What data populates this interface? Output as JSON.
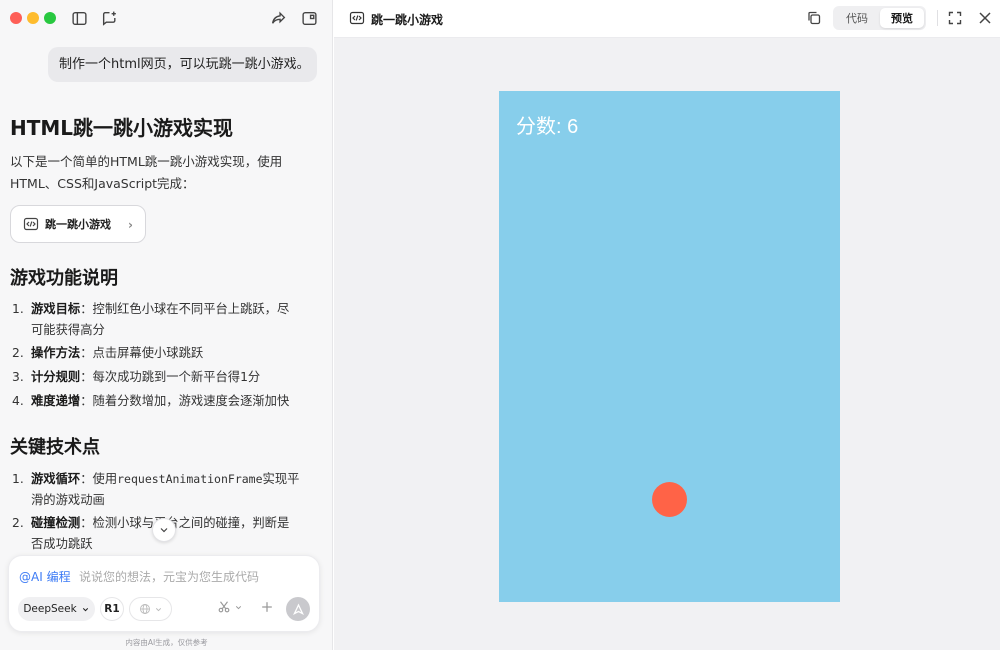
{
  "left": {
    "user_message": "制作一个html网页，可以玩跳一跳小游戏。",
    "heading": "HTML跳一跳小游戏实现",
    "intro_line1": "以下是一个简单的HTML跳一跳小游戏实现，使用",
    "intro_line2": "HTML、CSS和JavaScript完成：",
    "artifact_card": {
      "label": "跳一跳小游戏",
      "chevron": "›"
    },
    "section1_title": "游戏功能说明",
    "features": [
      {
        "num": "1.",
        "term": "游戏目标",
        "sep": "：",
        "text": "控制红色小球在不同平台上跳跃，尽",
        "text2": "可能获得高分"
      },
      {
        "num": "2.",
        "term": "操作方法",
        "sep": "：",
        "text": "点击屏幕使小球跳跃"
      },
      {
        "num": "3.",
        "term": "计分规则",
        "sep": "：",
        "text": "每次成功跳到一个新平台得1分"
      },
      {
        "num": "4.",
        "term": "难度递增",
        "sep": "：",
        "text": "随着分数增加，游戏速度会逐渐加快"
      }
    ],
    "section2_title": "关键技术点",
    "tech": [
      {
        "num": "1.",
        "term": "游戏循环",
        "sep": "：",
        "pre": "使用",
        "code": "requestAnimationFrame",
        "post": "实现平",
        "text2": "滑的游戏动画"
      },
      {
        "num": "2.",
        "term": "碰撞检测",
        "sep": "：",
        "text": "检测小球与平台之间的碰撞，判断是",
        "text2": "否成功跳跃"
      }
    ]
  },
  "input": {
    "ai_tag": "@AI 编程",
    "placeholder": "说说您的想法，元宝为您生成代码",
    "model": "DeepSeek",
    "model_chevron": "⌄",
    "r1": "R1",
    "footnote": "内容由AI生成，仅供参考"
  },
  "right": {
    "title": "跳一跳小游戏",
    "tab_code": "代码",
    "tab_preview": "预览",
    "active_tab": "预览"
  },
  "game": {
    "score_label": "分数: ",
    "score": "6",
    "sky_color": "#87ceeb",
    "ball_color": "#ff6347"
  },
  "icons": [
    "sidebar-toggle-icon",
    "new-chat-icon",
    "share-icon",
    "split-view-icon",
    "code-file-icon",
    "copy-icon",
    "fullscreen-icon",
    "close-icon",
    "scissors-icon",
    "plus-icon",
    "send-icon",
    "globe-icon"
  ]
}
